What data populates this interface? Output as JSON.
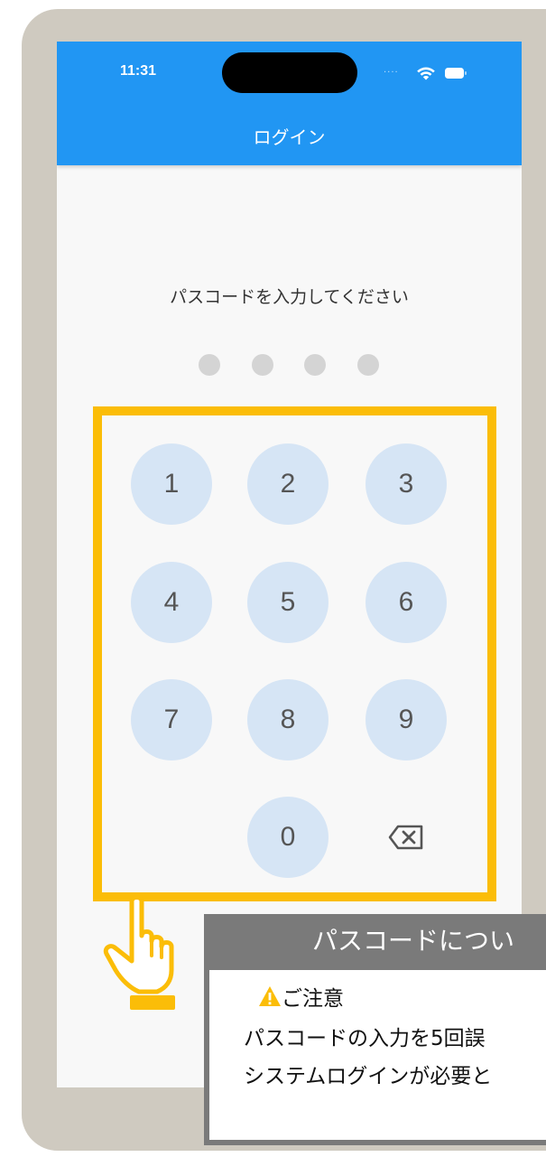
{
  "status_bar": {
    "time": "11:31",
    "signal_dots": "....",
    "wifi_icon": "wifi-icon",
    "battery_icon": "battery-icon"
  },
  "appbar": {
    "title": "ログイン",
    "color": "#2196f3"
  },
  "prompt": "パスコードを入力してください",
  "passcode": {
    "length": 4,
    "entered": 0
  },
  "keypad": {
    "keys": [
      "1",
      "2",
      "3",
      "4",
      "5",
      "6",
      "7",
      "8",
      "9",
      "0"
    ],
    "backspace_icon": "backspace-icon"
  },
  "annotation": {
    "highlight_color": "#fbbd08",
    "pointer_icon": "pointing-hand-icon",
    "callout_title": "パスコードについ",
    "caution_icon": "warning-icon",
    "caution_label": "ご注意",
    "body_line1": "パスコードの入力を5回誤",
    "body_line2": "システムログインが必要と"
  }
}
